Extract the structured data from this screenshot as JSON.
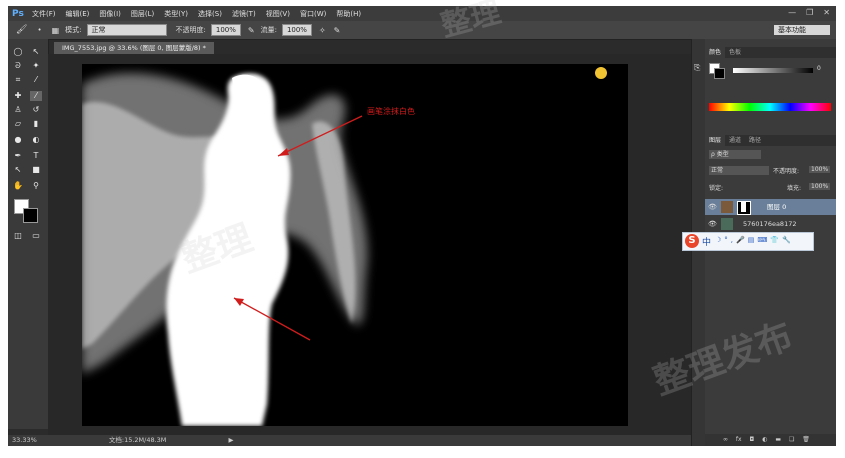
{
  "app": {
    "logo": "Ps"
  },
  "menu": [
    "文件(F)",
    "编辑(E)",
    "图像(I)",
    "图层(L)",
    "类型(Y)",
    "选择(S)",
    "滤镜(T)",
    "视图(V)",
    "窗口(W)",
    "帮助(H)"
  ],
  "options": {
    "mode_label": "模式:",
    "mode_value": "正常",
    "opacity_label": "不透明度:",
    "opacity_value": "100%",
    "flow_label": "流量:",
    "flow_value": "100%",
    "workspace": "基本功能"
  },
  "document": {
    "tab": "IMG_7553.jpg @ 33.6% (图层 0, 图层蒙版/8) *",
    "annotation": "画笔涂抹白色"
  },
  "status": {
    "zoom": "33.33%",
    "doc": "文档:15.2M/48.3M"
  },
  "panels": {
    "color_tabs": [
      "颜色",
      "色板"
    ],
    "layer_tabs": [
      "图层",
      "通道",
      "路径"
    ],
    "kind_label": "ρ 类型",
    "blend_mode": "正常",
    "opacity_label": "不透明度:",
    "opacity_value": "100%",
    "lock_label": "锁定:",
    "fill_label": "填充:",
    "fill_value": "100%",
    "layers": [
      {
        "name": "图层 0"
      },
      {
        "name": "5760176ea8172"
      }
    ]
  },
  "watermarks": [
    "整理",
    "整理",
    "整理发布"
  ],
  "colors": {
    "annotation": "#d11c1c",
    "sogou": "#e8452a",
    "ps_blue": "#5fb0ff"
  }
}
